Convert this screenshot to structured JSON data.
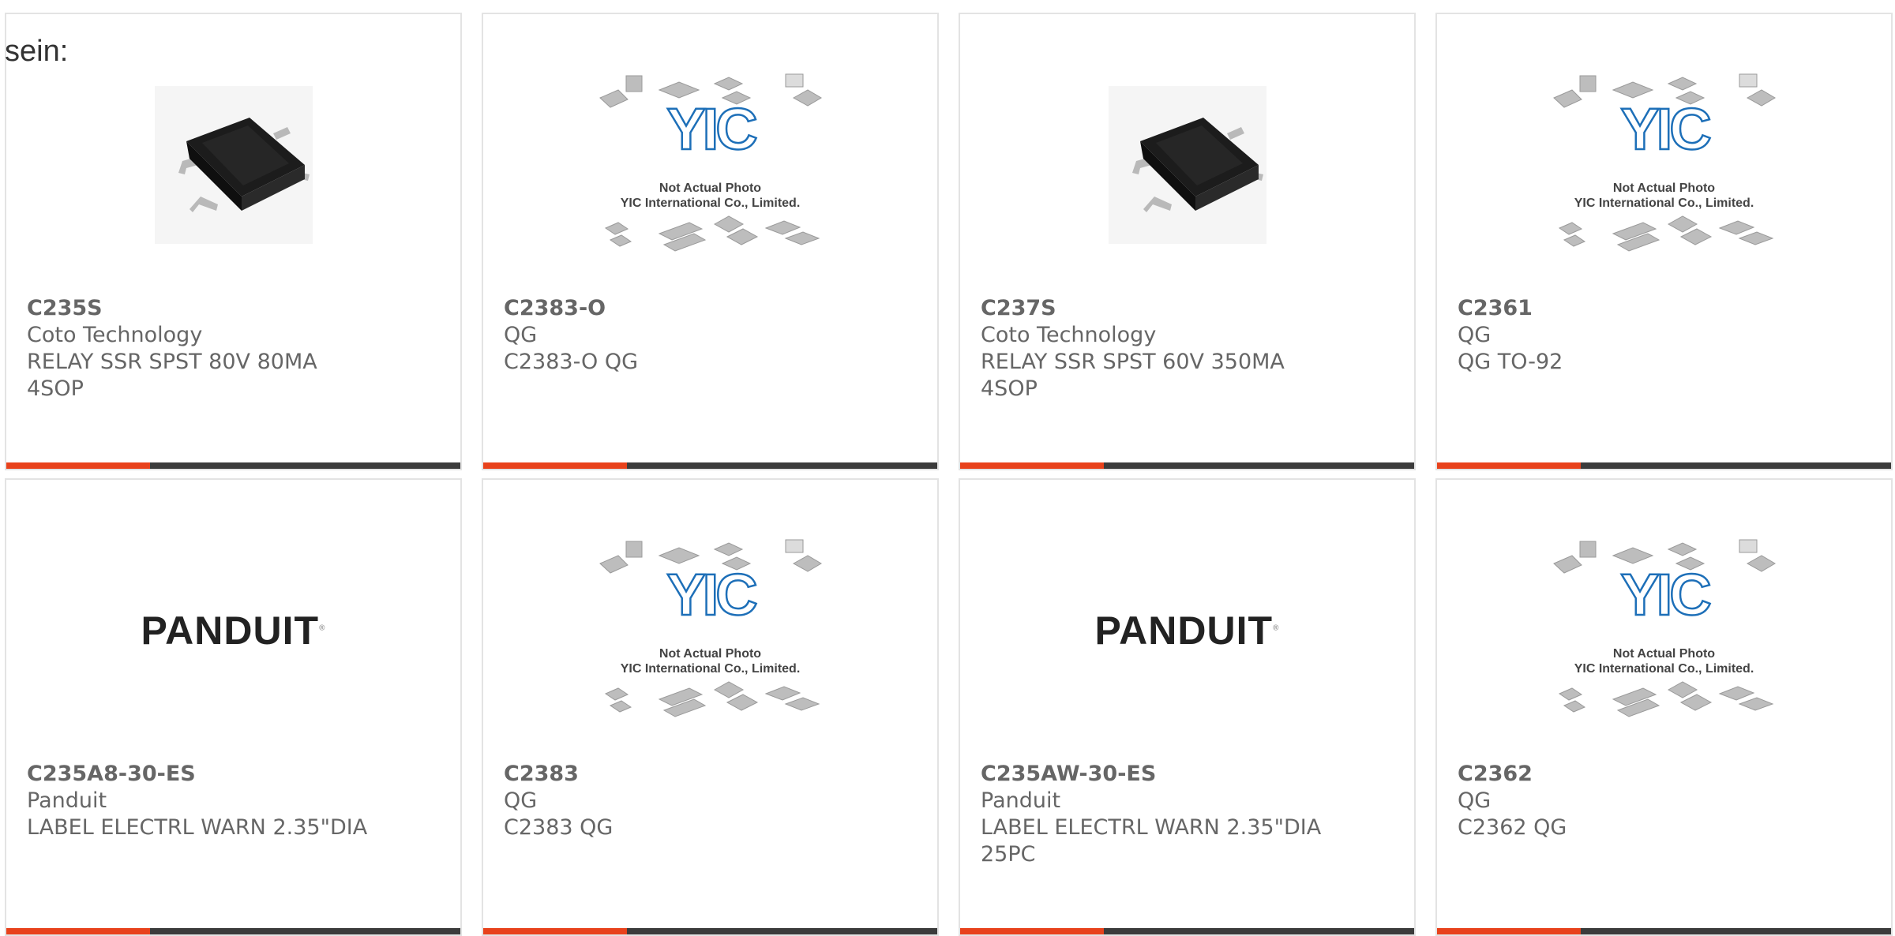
{
  "lead_text": "sein:",
  "products": [
    {
      "part": "C235S",
      "manufacturer": "Coto Technology",
      "description": "RELAY SSR SPST 80V 80MA 4SOP",
      "image": "relay-chip"
    },
    {
      "part": "C2383-O",
      "manufacturer": "QG",
      "description": "C2383-O QG",
      "image": "yic-placeholder"
    },
    {
      "part": "C237S",
      "manufacturer": "Coto Technology",
      "description": "RELAY SSR SPST 60V 350MA 4SOP",
      "image": "relay-chip"
    },
    {
      "part": "C2361",
      "manufacturer": "QG",
      "description": "QG TO-92",
      "image": "yic-placeholder"
    },
    {
      "part": "C235A8-30-ES",
      "manufacturer": "Panduit",
      "description": "LABEL ELECTRL WARN 2.35\"DIA",
      "image": "panduit-logo"
    },
    {
      "part": "C2383",
      "manufacturer": "QG",
      "description": "C2383 QG",
      "image": "yic-placeholder"
    },
    {
      "part": "C235AW-30-ES",
      "manufacturer": "Panduit",
      "description": "LABEL ELECTRL WARN 2.35\"DIA 25PC",
      "image": "panduit-logo"
    },
    {
      "part": "C2362",
      "manufacturer": "QG",
      "description": "C2362 QG",
      "image": "yic-placeholder"
    }
  ],
  "placeholder": {
    "line1": "Not Actual Photo",
    "line2": "YIC International Co., Limited.",
    "logo_text": "YIC"
  },
  "panduit_logo_text": "PANDUIT",
  "colors": {
    "accent": "#e8421c",
    "bar": "#3b3b3b",
    "border": "#e3e3e3",
    "yic_blue": "#1d6fb8"
  }
}
